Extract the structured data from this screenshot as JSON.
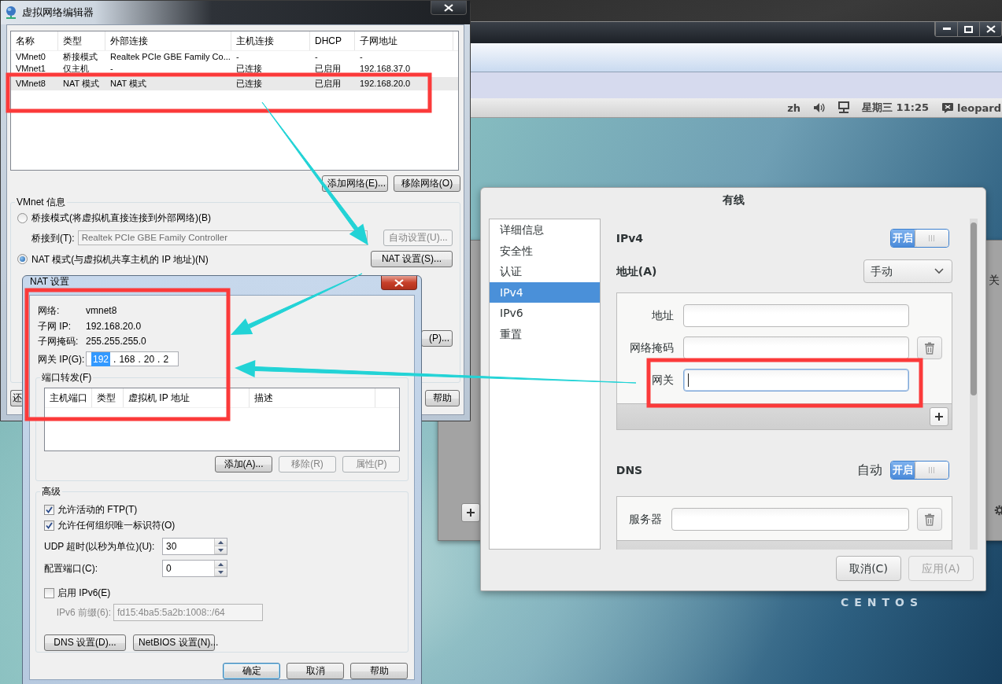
{
  "top_bar": {
    "language": "zh",
    "clock": "星期三 11:25",
    "user": "leopard"
  },
  "desktop": {
    "logo_text": "CENTOS"
  },
  "background_window": {
    "label": "关"
  },
  "wired_settings": {
    "title": "有线",
    "sidebar": [
      {
        "label": "详细信息",
        "selected": false
      },
      {
        "label": "安全性",
        "selected": false
      },
      {
        "label": "认证",
        "selected": false
      },
      {
        "label": "IPv4",
        "selected": true
      },
      {
        "label": "IPv6",
        "selected": false
      },
      {
        "label": "重置",
        "selected": false
      }
    ],
    "ipv4": {
      "title": "IPv4",
      "switch": {
        "label": "开启",
        "on": true
      },
      "address_label": "地址(A)",
      "method": "手动",
      "fields": [
        {
          "label": "地址",
          "focused": false,
          "removable": false
        },
        {
          "label": "网络掩码",
          "focused": false,
          "removable": true
        },
        {
          "label": "网关",
          "focused": true,
          "removable": false
        }
      ]
    },
    "dns": {
      "title": "DNS",
      "auto_label": "自动",
      "switch": {
        "label": "开启",
        "on": true
      },
      "fields": [
        {
          "label": "服务器",
          "focused": false,
          "removable": true
        }
      ]
    },
    "buttons": [
      {
        "label": "取消(C)",
        "disabled": false
      },
      {
        "label": "应用(A)",
        "disabled": true
      }
    ]
  },
  "network_editor": {
    "title": "虚拟网络编辑器",
    "table": {
      "columns": [
        "名称",
        "类型",
        "外部连接",
        "主机连接",
        "DHCP",
        "子网地址"
      ],
      "rows": [
        {
          "cells": [
            "VMnet0",
            "桥接模式",
            "Realtek PCIe GBE Family Co...",
            "-",
            "-",
            "-"
          ],
          "selected": false
        },
        {
          "cells": [
            "VMnet1",
            "仅主机",
            "-",
            "已连接",
            "已启用",
            "192.168.37.0"
          ],
          "selected": false
        },
        {
          "cells": [
            "VMnet8",
            "NAT 模式",
            "NAT 模式",
            "已连接",
            "已启用",
            "192.168.20.0"
          ],
          "selected": true
        }
      ]
    },
    "list_buttons": [
      {
        "label": "添加网络(E)...",
        "disabled": false
      },
      {
        "label": "移除网络(O)",
        "disabled": false
      }
    ],
    "info": {
      "title": "VMnet 信息",
      "modes": [
        {
          "label": "桥接模式(将虚拟机直接连接到外部网络)(B)",
          "selected": false
        },
        {
          "label": "NAT 模式(与虚拟机共享主机的 IP 地址)(N)",
          "selected": true
        }
      ],
      "bridge_label": "桥接到(T):",
      "bridge_value": "Realtek PCIe GBE Family Controller",
      "bridge_disabled": true,
      "auto_button": {
        "label": "自动设置(U)...",
        "disabled": true
      },
      "nat_button": {
        "label": "NAT 设置(S)...",
        "disabled": false
      },
      "dhcp_button": {
        "label": "(P)...",
        "disabled": false
      }
    },
    "footer_buttons": [
      {
        "label": "还",
        "disabled": false
      },
      {
        "label": "帮助",
        "disabled": false
      }
    ]
  },
  "nat_settings": {
    "title": "NAT 设置",
    "info": [
      {
        "label": "网络:",
        "value": "vmnet8"
      },
      {
        "label": "子网 IP:",
        "value": "192.168.20.0"
      },
      {
        "label": "子网掩码:",
        "value": "255.255.255.0"
      }
    ],
    "gateway": {
      "label": "网关 IP(G):",
      "separator": ".",
      "octets": [
        {
          "value": "192",
          "selected": true
        },
        {
          "value": "168",
          "selected": false
        },
        {
          "value": "20",
          "selected": false
        },
        {
          "value": "2",
          "selected": false
        }
      ]
    },
    "port_forwarding": {
      "title": "端口转发(F)",
      "columns": [
        "主机端口",
        "类型",
        "虚拟机 IP 地址",
        "描述"
      ],
      "buttons": [
        {
          "label": "添加(A)...",
          "disabled": false
        },
        {
          "label": "移除(R)",
          "disabled": true
        },
        {
          "label": "属性(P)",
          "disabled": true
        }
      ]
    },
    "advanced": {
      "title": "高级",
      "options": [
        {
          "label": "允许活动的 FTP(T)",
          "checked": true
        },
        {
          "label": "允许任何组织唯一标识符(O)",
          "checked": true
        }
      ],
      "udp_timeout": {
        "label": "UDP 超时(以秒为单位)(U):",
        "value": "30"
      },
      "config_port": {
        "label": "配置端口(C):",
        "value": "0"
      },
      "ipv6": {
        "label": "启用 IPv6(E)",
        "checked": false
      },
      "ipv6_prefix": {
        "label": "IPv6 前缀(6):",
        "value": "fd15:4ba5:5a2b:1008::/64",
        "disabled": true
      },
      "buttons": [
        {
          "label": "DNS 设置(D)...",
          "disabled": false
        },
        {
          "label": "NetBIOS 设置(N)...",
          "disabled": false
        }
      ]
    },
    "buttons": [
      {
        "label": "确定",
        "default": true
      },
      {
        "label": "取消",
        "default": false
      },
      {
        "label": "帮助",
        "default": false
      }
    ]
  }
}
